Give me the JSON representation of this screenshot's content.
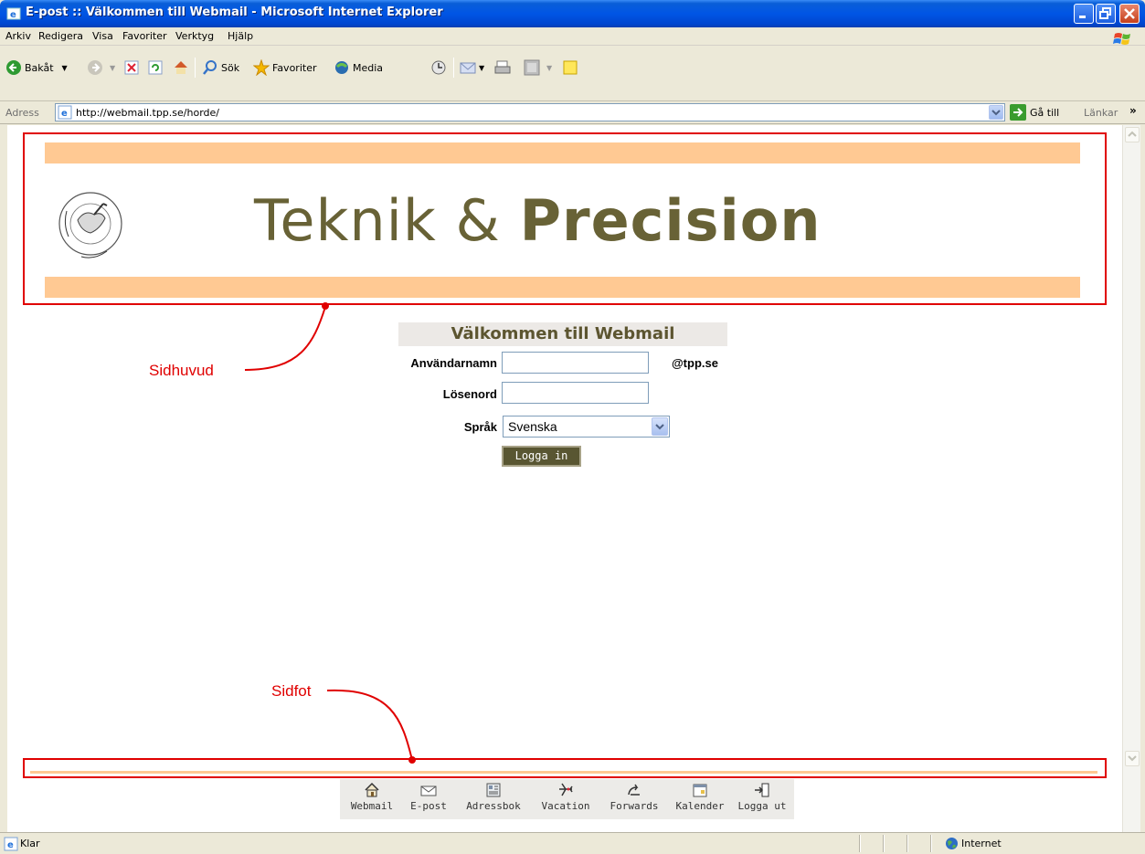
{
  "window": {
    "title": "E-post :: Välkommen till Webmail - Microsoft Internet Explorer"
  },
  "menu": [
    "Arkiv",
    "Redigera",
    "Visa",
    "Favoriter",
    "Verktyg",
    "Hjälp"
  ],
  "toolbar": {
    "back": "Bakåt",
    "search": "Sök",
    "favorites": "Favoriter",
    "media": "Media"
  },
  "address": {
    "label": "Adress",
    "url": "http://webmail.tpp.se/horde/",
    "go": "Gå till",
    "links": "Länkar",
    "more": "»"
  },
  "header": {
    "brand_regular": "Teknik & ",
    "brand_bold": "Precision",
    "logo_text": "TEKNIK & PRECISION"
  },
  "annotations": {
    "header_label": "Sidhuvud",
    "footer_label": "Sidfot"
  },
  "login": {
    "title": "Välkommen till Webmail",
    "username_label": "Användarnamn",
    "username_value": "",
    "domain": "@tpp.se",
    "password_label": "Lösenord",
    "password_value": "",
    "language_label": "Språk",
    "language_value": "Svenska",
    "submit": "Logga in"
  },
  "nav": [
    {
      "label": "Webmail",
      "icon": "home-icon"
    },
    {
      "label": "E-post",
      "icon": "envelope-icon"
    },
    {
      "label": "Adressbok",
      "icon": "addressbook-icon"
    },
    {
      "label": "Vacation",
      "icon": "airplane-icon"
    },
    {
      "label": "Forwards",
      "icon": "forward-icon"
    },
    {
      "label": "Kalender",
      "icon": "calendar-icon"
    },
    {
      "label": "Logga ut",
      "icon": "logout-icon"
    }
  ],
  "status": {
    "text": "Klar",
    "zone": "Internet"
  },
  "colors": {
    "accent_band": "#ffc993",
    "brand_text": "#686236",
    "annotation": "#e00000",
    "button": "#595632"
  }
}
